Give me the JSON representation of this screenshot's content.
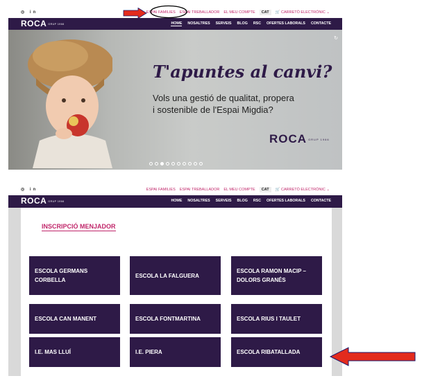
{
  "colors": {
    "brand_purple": "#2e1a47",
    "accent_pink": "#c0266a",
    "annotation_red": "#e32b1d"
  },
  "social": {
    "icons": [
      "instagram-icon",
      "linkedin-icon"
    ],
    "text": "◎ in"
  },
  "utility_links": {
    "families": "ESPAI FAMILIES",
    "workers": "ESPAI TREBALLADOR",
    "account": "EL MEU COMPTE",
    "language": "CAT",
    "cart": "CARRETÓ ELECTRÒNIC"
  },
  "nav": {
    "logo": "ROCA",
    "logo_tagline": "GRUP 1966",
    "items": [
      "HOME",
      "NOSALTRES",
      "SERVEIS",
      "BLOG",
      "RSC",
      "OFERTES LABORALS",
      "CONTACTE"
    ],
    "active_index": 0
  },
  "hero": {
    "title": "T'apuntes al canvi?",
    "subtitle_line1": "Vols una gestió de qualitat, propera",
    "subtitle_line2": "i sostenible de l'Espai Migdia?",
    "logo": "ROCA",
    "logo_tagline": "GRUP 1966",
    "slides_total": 10,
    "current_slide": 2
  },
  "section": {
    "title": "INSCRIPCIÓ MENJADOR",
    "schools": [
      "ESCOLA GERMANS CORBELLA",
      "ESCOLA LA FALGUERA",
      "ESCOLA RAMON MACIP – DOLORS GRANÉS",
      "ESCOLA CAN MANENT",
      "ESCOLA FONTMARTINA",
      "ESCOLA RIUS I TAULET",
      "I.E. MAS LLUÍ",
      "I.E. PIERA",
      "ESCOLA RIBATALLADA"
    ]
  }
}
